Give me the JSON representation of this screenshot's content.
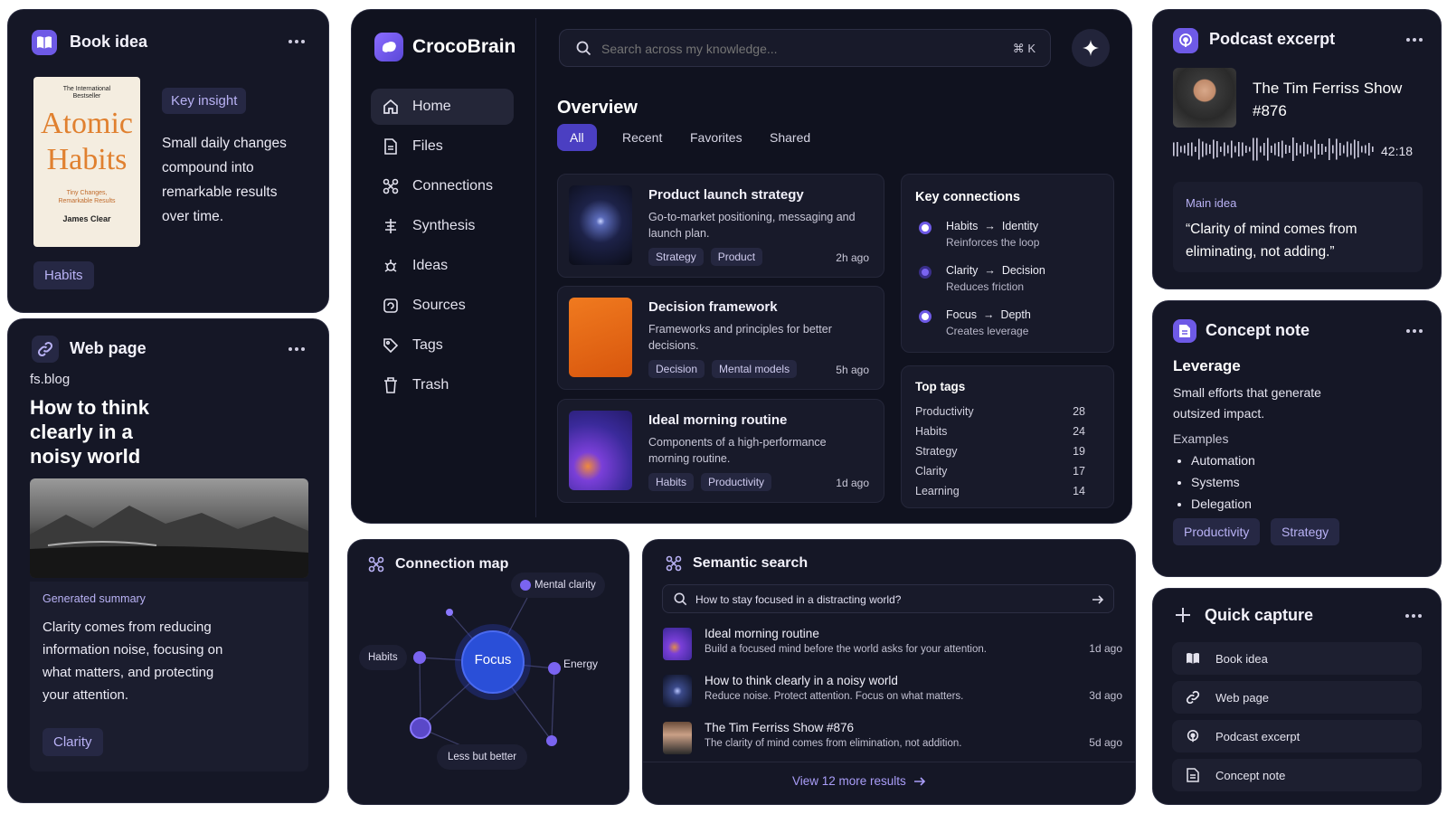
{
  "book_card": {
    "title": "Book idea",
    "cover": {
      "kicker": "The International Bestseller",
      "title": "Atomic Habits",
      "subtitle": "Tiny Changes, Remarkable Results",
      "author": "James Clear"
    },
    "badge": "Key insight",
    "insight": "Small daily changes compound into remarkable results over time.",
    "tag": "Habits",
    "icon": "book-icon"
  },
  "web_card": {
    "title": "Web page",
    "domain": "fs.blog",
    "headline": "How to think clearly in a noisy world",
    "summary_label": "Generated summary",
    "summary": "Clarity comes from reducing information noise, focusing on what matters, and protecting your attention.",
    "tag": "Clarity",
    "icon": "link-icon"
  },
  "app": {
    "brand": "CrocoBrain",
    "search_placeholder": "Search across my knowledge...",
    "search_shortcut": "⌘ K",
    "nav": [
      {
        "label": "Home",
        "icon": "home-icon",
        "active": true
      },
      {
        "label": "Files",
        "icon": "file-icon"
      },
      {
        "label": "Connections",
        "icon": "command-icon"
      },
      {
        "label": "Synthesis",
        "icon": "synthesis-icon"
      },
      {
        "label": "Ideas",
        "icon": "sparkle-bug-icon"
      },
      {
        "label": "Sources",
        "icon": "sources-icon"
      },
      {
        "label": "Tags",
        "icon": "tag-icon"
      },
      {
        "label": "Trash",
        "icon": "trash-icon"
      }
    ],
    "overview": {
      "title": "Overview",
      "tabs": [
        "All",
        "Recent",
        "Favorites",
        "Shared"
      ],
      "cards": [
        {
          "title": "Product launch strategy",
          "desc": "Go-to-market positioning, messaging and launch plan.",
          "tags": [
            "Strategy",
            "Product"
          ],
          "time": "2h ago"
        },
        {
          "title": "Decision framework",
          "desc": "Frameworks and principles for better decisions.",
          "tags": [
            "Decision",
            "Mental models"
          ],
          "time": "5h ago"
        },
        {
          "title": "Ideal morning routine",
          "desc": "Components of a high-performance morning routine.",
          "tags": [
            "Habits",
            "Productivity"
          ],
          "time": "1d ago"
        }
      ]
    },
    "key_connections": {
      "title": "Key connections",
      "items": [
        {
          "from": "Habits",
          "to": "Identity",
          "note": "Reinforces the loop"
        },
        {
          "from": "Clarity",
          "to": "Decision",
          "note": "Reduces friction"
        },
        {
          "from": "Focus",
          "to": "Depth",
          "note": "Creates leverage"
        }
      ]
    },
    "top_tags": {
      "title": "Top tags",
      "items": [
        {
          "name": "Productivity",
          "count": "28"
        },
        {
          "name": "Habits",
          "count": "24"
        },
        {
          "name": "Strategy",
          "count": "19"
        },
        {
          "name": "Clarity",
          "count": "17"
        },
        {
          "name": "Learning",
          "count": "14"
        }
      ]
    }
  },
  "connection_map": {
    "title": "Connection map",
    "center": "Focus",
    "nodes": {
      "mental": "Mental clarity",
      "habits": "Habits",
      "energy": "Energy",
      "less": "Less but better"
    }
  },
  "semantic": {
    "title": "Semantic search",
    "query": "How to stay focused in a distracting world?",
    "results": [
      {
        "title": "Ideal morning routine",
        "desc": "Build a focused mind before the world asks for your attention.",
        "time": "1d ago"
      },
      {
        "title": "How to think clearly in a noisy world",
        "desc": "Reduce noise. Protect attention. Focus on what matters.",
        "time": "3d ago"
      },
      {
        "title": "The Tim Ferriss Show #876",
        "desc": "The clarity of mind comes from elimination, not addition.",
        "time": "5d ago"
      }
    ],
    "more": "View 12 more results"
  },
  "podcast": {
    "title": "Podcast excerpt",
    "show": "The Tim Ferriss Show #876",
    "duration": "42:18",
    "label": "Main idea",
    "quote": "“Clarity of mind comes from eliminating, not adding.”"
  },
  "concept": {
    "title": "Concept note",
    "heading": "Leverage",
    "desc": "Small efforts that generate outsized impact.",
    "examples_label": "Examples",
    "examples": [
      "Automation",
      "Systems",
      "Delegation"
    ],
    "tags": [
      "Productivity",
      "Strategy"
    ]
  },
  "quick": {
    "title": "Quick capture",
    "items": [
      {
        "label": "Book idea",
        "icon": "book-icon"
      },
      {
        "label": "Web page",
        "icon": "link-icon"
      },
      {
        "label": "Podcast excerpt",
        "icon": "podcast-icon"
      },
      {
        "label": "Concept note",
        "icon": "note-icon"
      }
    ]
  },
  "colors": {
    "accent": "#6e5ae6",
    "card_bg": "#151726",
    "app_bg": "#10121f",
    "tag_text": "#b9b2f5"
  }
}
